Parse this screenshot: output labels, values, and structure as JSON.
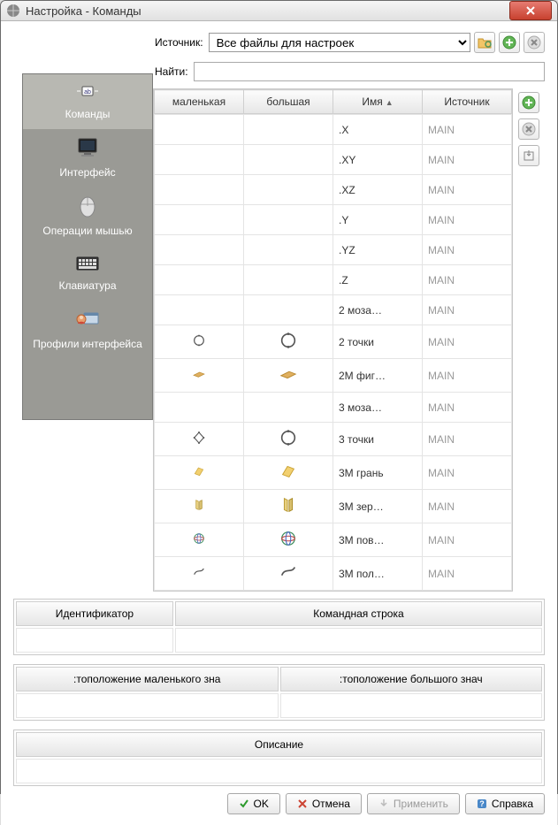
{
  "window": {
    "title": "Настройка - Команды"
  },
  "source": {
    "label": "Источник:",
    "selected": "Все файлы для настроек"
  },
  "search": {
    "label": "Найти:",
    "value": ""
  },
  "sidebar": {
    "items": [
      {
        "label": "Команды"
      },
      {
        "label": "Интерфейс"
      },
      {
        "label": "Операции мышью"
      },
      {
        "label": "Клавиатура"
      },
      {
        "label": "Профили интерфейса"
      }
    ]
  },
  "table": {
    "headers": {
      "small": "маленькая",
      "big": "большая",
      "name": "Имя",
      "source": "Источник"
    },
    "rows": [
      {
        "small": "",
        "big": "",
        "name": ".X",
        "source": "MAIN"
      },
      {
        "small": "",
        "big": "",
        "name": ".XY",
        "source": "MAIN"
      },
      {
        "small": "",
        "big": "",
        "name": ".XZ",
        "source": "MAIN"
      },
      {
        "small": "",
        "big": "",
        "name": ".Y",
        "source": "MAIN"
      },
      {
        "small": "",
        "big": "",
        "name": ".YZ",
        "source": "MAIN"
      },
      {
        "small": "",
        "big": "",
        "name": ".Z",
        "source": "MAIN"
      },
      {
        "small": "",
        "big": "",
        "name": "2 моза…",
        "source": "MAIN"
      },
      {
        "small": "circle",
        "big": "circle-big",
        "name": "2 точки",
        "source": "MAIN"
      },
      {
        "small": "brick",
        "big": "brick-big",
        "name": "2М фиг…",
        "source": "MAIN"
      },
      {
        "small": "",
        "big": "",
        "name": "3 моза…",
        "source": "MAIN"
      },
      {
        "small": "diamond",
        "big": "circle-big",
        "name": "3 точки",
        "source": "MAIN"
      },
      {
        "small": "face",
        "big": "face-big",
        "name": "3М грань",
        "source": "MAIN"
      },
      {
        "small": "mirror",
        "big": "mirror-big",
        "name": "3М зер…",
        "source": "MAIN"
      },
      {
        "small": "globe",
        "big": "globe-big",
        "name": "3М пов…",
        "source": "MAIN"
      },
      {
        "small": "curve",
        "big": "curve-big",
        "name": "3М пол…",
        "source": "MAIN"
      }
    ]
  },
  "bottom": {
    "id_header": "Идентификатор",
    "cmd_header": "Командная строка",
    "small_loc_header": ":тоположение маленького зна",
    "big_loc_header": ":тоположение большого знач",
    "desc_header": "Описание"
  },
  "buttons": {
    "ok": "OK",
    "cancel": "Отмена",
    "apply": "Применить",
    "help": "Справка"
  }
}
